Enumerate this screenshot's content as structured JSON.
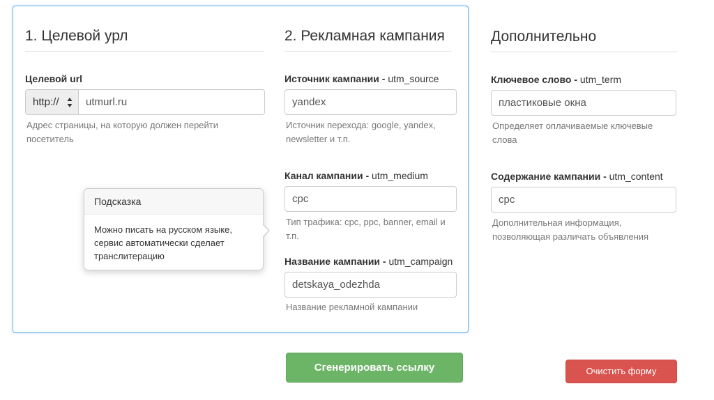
{
  "sections": {
    "target": {
      "heading": "1. Целевой урл",
      "label": "Целевой url",
      "protocol": "http://",
      "value": "utmurl.ru",
      "help": "Адрес страницы, на которую должен перейти посетитель"
    },
    "campaign": {
      "heading": "2. Рекламная кампания",
      "source": {
        "label_bold": "Источник кампании - ",
        "label_param": "utm_source",
        "value": "yandex",
        "help": "Источник перехода: google, yandex, newsletter и т.п."
      },
      "medium": {
        "label_bold": "Канал кампании - ",
        "label_param": "utm_medium",
        "value": "cpc",
        "help": "Тип трафика: cpc, ppc, banner, email и т.п."
      },
      "name": {
        "label_bold": "Название кампании - ",
        "label_param": "utm_campaign",
        "value": "detskaya_odezhda",
        "help": "Название рекламной кампании"
      }
    },
    "extra": {
      "heading": "Дополнительно",
      "term": {
        "label_bold": "Ключевое слово - ",
        "label_param": "utm_term",
        "value": "пластиковые окна",
        "help": "Определяет оплачиваемые ключевые слова"
      },
      "content": {
        "label_bold": "Содержание кампании - ",
        "label_param": "utm_content",
        "value": "cpc",
        "help": "Дополнительная информация, позволяющая различать объявления"
      }
    }
  },
  "popover": {
    "title": "Подсказка",
    "body": "Можно писать на русском языке, сервис автоматически сделает транслитерацию"
  },
  "buttons": {
    "generate": "Сгенерировать ссылку",
    "clear": "Очистить форму"
  },
  "colors": {
    "panel_border": "#66afe9",
    "generate_button": "#6cb567",
    "clear_button": "#d9534f"
  }
}
